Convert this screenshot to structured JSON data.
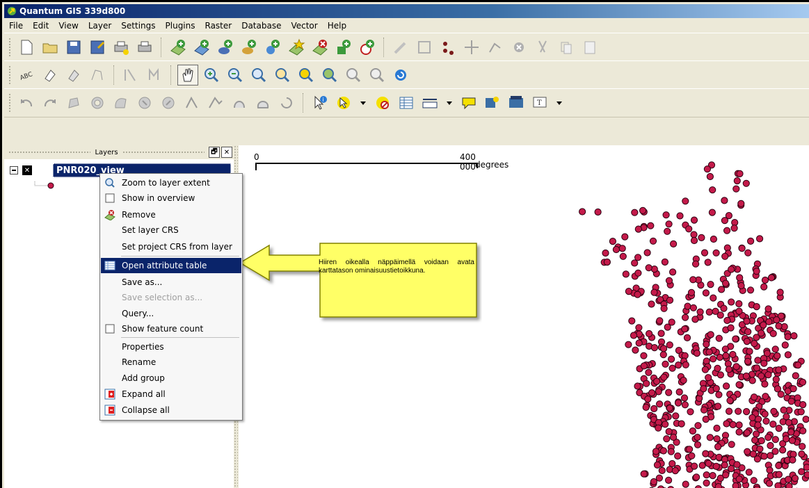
{
  "window": {
    "title": "Quantum GIS 339d800"
  },
  "menubar": {
    "items": [
      "File",
      "Edit",
      "View",
      "Layer",
      "Settings",
      "Plugins",
      "Raster",
      "Database",
      "Vector",
      "Help"
    ]
  },
  "layers_panel": {
    "title": "Layers",
    "float_button": "🗗",
    "close_button": "✕",
    "layer_name": "PNR020_view",
    "layer_checked": "✕"
  },
  "scale_bar": {
    "start": "0",
    "end": "400 000",
    "unit": "degrees"
  },
  "context_menu": {
    "items": [
      {
        "label": "Zoom to layer extent",
        "icon": "zoom-layer-icon"
      },
      {
        "label": "Show in overview",
        "icon": "checkbox-icon"
      },
      {
        "label": "Remove",
        "icon": "remove-layer-icon"
      },
      {
        "label": "Set layer CRS",
        "icon": ""
      },
      {
        "label": "Set project CRS from layer",
        "icon": ""
      },
      {
        "label": "Open attribute table",
        "icon": "attribute-table-icon"
      },
      {
        "label": "Save as...",
        "icon": ""
      },
      {
        "label": "Save selection as...",
        "icon": ""
      },
      {
        "label": "Query...",
        "icon": ""
      },
      {
        "label": "Show feature count",
        "icon": "checkbox-icon"
      },
      {
        "label": "Properties",
        "icon": ""
      },
      {
        "label": "Rename",
        "icon": ""
      },
      {
        "label": "Add group",
        "icon": ""
      },
      {
        "label": "Expand all",
        "icon": "expand-all-icon"
      },
      {
        "label": "Collapse all",
        "icon": "collapse-all-icon"
      }
    ]
  },
  "callout": {
    "text": "Hiiren oikealla näppäimellä voidaan avata karttatason ominaisuustietoikkuna."
  },
  "colors": {
    "point_fill": "#c41a4a",
    "point_stroke": "#2a0010",
    "selection": "#0a246a",
    "callout_fill": "#ffff66"
  }
}
